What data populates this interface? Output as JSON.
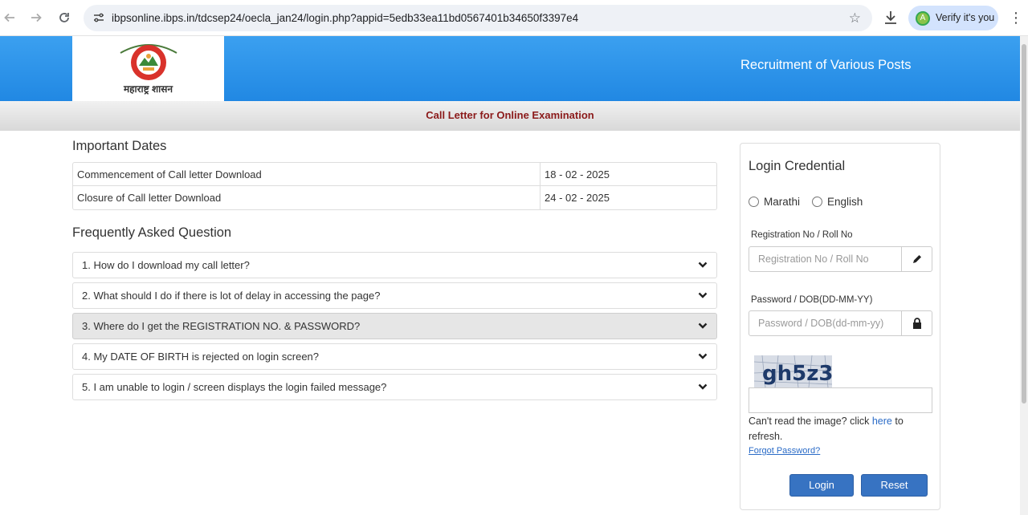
{
  "browser": {
    "url": "ibpsonline.ibps.in/tdcsep24/oecla_jan24/login.php?appid=5edb33ea11bd0567401b34650f3397e4",
    "verify_label": "Verify it's you",
    "avatar_letter": "A"
  },
  "header": {
    "logo_caption": "महाराष्ट्र शासन",
    "title": "Recruitment of Various Posts"
  },
  "subheader": {
    "title": "Call Letter for Online Examination"
  },
  "important_dates": {
    "heading": "Important Dates",
    "rows": [
      {
        "label": "Commencement of Call letter Download",
        "value": "18 - 02 - 2025"
      },
      {
        "label": "Closure of Call letter Download",
        "value": "24 - 02 - 2025"
      }
    ]
  },
  "faq": {
    "heading": "Frequently Asked Question",
    "items": [
      "1. How do I download my call letter?",
      "2. What should I do if there is lot of delay in accessing the page?",
      "3. Where do I get the REGISTRATION NO. & PASSWORD?",
      "4. My DATE OF BIRTH is rejected on login screen?",
      "5. I am unable to login / screen displays the login failed message?"
    ],
    "active_index": 2
  },
  "login": {
    "heading": "Login Credential",
    "languages": [
      "Marathi",
      "English"
    ],
    "reg_label": "Registration No / Roll No",
    "reg_placeholder": "Registration No / Roll No",
    "pwd_label": "Password / DOB(DD-MM-YY)",
    "pwd_placeholder": "Password / DOB(dd-mm-yy)",
    "captcha_text": "gh5z3",
    "cant_read_prefix": "Can't read the image? click ",
    "cant_read_link": "here",
    "cant_read_suffix": " to refresh.",
    "forgot": "Forgot Password?",
    "login_button": "Login",
    "reset_button": "Reset"
  },
  "colors": {
    "header_blue": "#2188e3",
    "subtitle_red": "#8b1a1a",
    "button_blue": "#3773c2",
    "link_blue": "#2a6bc7"
  },
  "icons": [
    "back-arrow-icon",
    "forward-arrow-icon",
    "reload-icon",
    "site-info-icon",
    "bookmark-star-icon",
    "download-icon",
    "kebab-menu-icon",
    "pencil-icon",
    "lock-icon",
    "chevron-down-icon"
  ]
}
